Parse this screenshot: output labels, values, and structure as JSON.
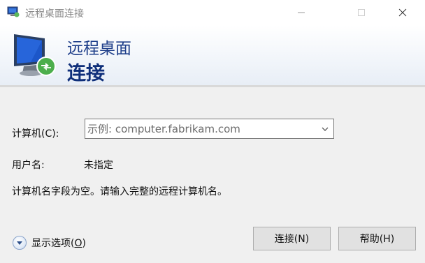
{
  "window": {
    "title": "远程桌面连接",
    "minimize_glyph": "—",
    "maximize_glyph": "☐",
    "close_glyph": "✕"
  },
  "banner": {
    "subtitle": "远程桌面",
    "title": "连接",
    "icon": "remote-desktop-monitor-icon"
  },
  "form": {
    "computer_label": "计算机(C):",
    "computer_placeholder": "示例: computer.fabrikam.com",
    "computer_value": "",
    "user_label": "用户名:",
    "user_value": "未指定",
    "message": "计算机名字段为空。请输入完整的远程计算机名。"
  },
  "footer": {
    "options_label": "显示选项(",
    "options_accel": "O",
    "options_label_end": ")",
    "connect_button": "连接(N)",
    "help_button": "帮助(H)"
  },
  "colors": {
    "accent_text": "#0f2f7a",
    "window_bg": "#f0f0f0",
    "button_bg": "#e1e1e1"
  }
}
